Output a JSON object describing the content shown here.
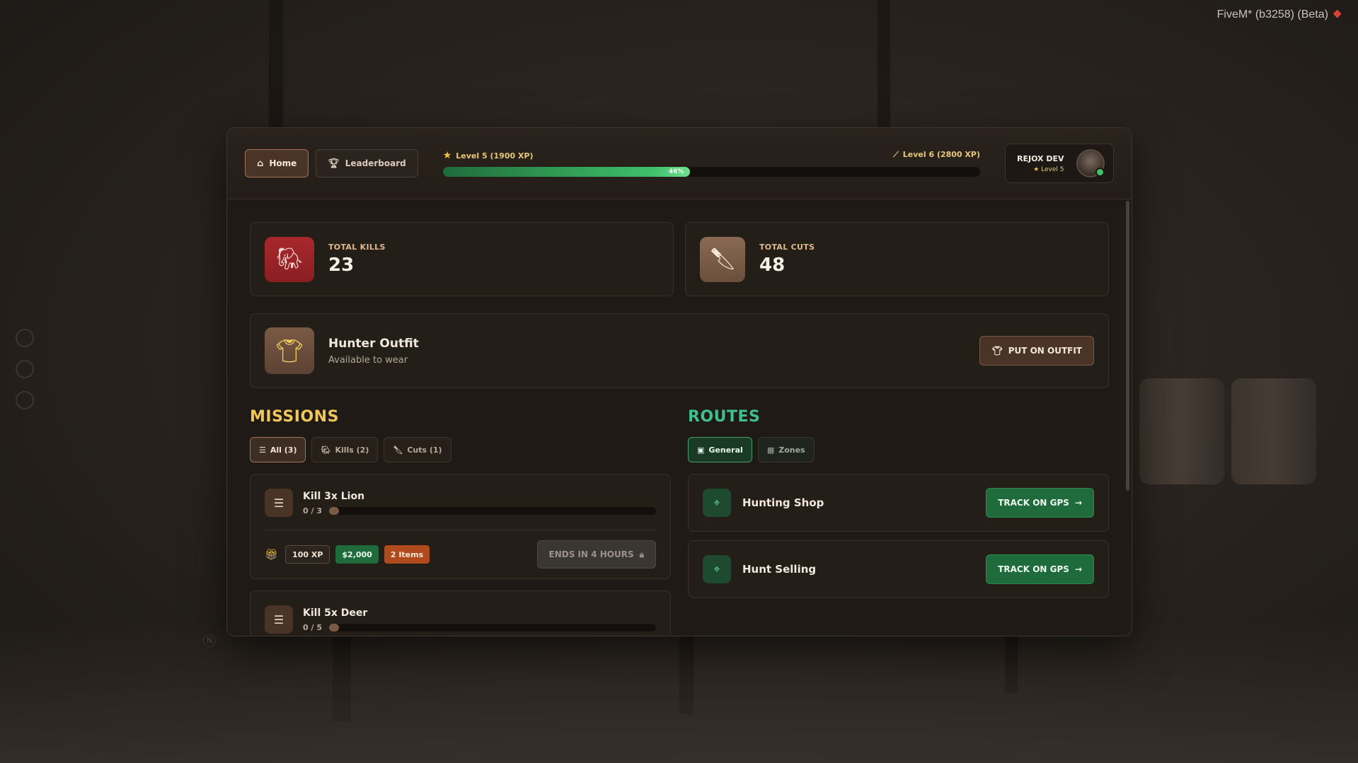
{
  "overlay": {
    "fivem_label": "FiveM* (b3258) (Beta)"
  },
  "nav": {
    "home_label": "Home",
    "leaderboard_label": "Leaderboard"
  },
  "xp": {
    "current_level": "Level 5 (1900 XP)",
    "next_level": "Level 6 (2800 XP)",
    "percent_label": "46%",
    "percent_value": 46
  },
  "profile": {
    "name": "REJOX DEV",
    "level": "Level 5"
  },
  "stats": {
    "kills_label": "TOTAL KILLS",
    "kills_value": "23",
    "cuts_label": "TOTAL CUTS",
    "cuts_value": "48"
  },
  "outfit": {
    "title": "Hunter Outfit",
    "subtitle": "Available to wear",
    "button_label": "PUT ON OUTFIT"
  },
  "missions": {
    "title": "MISSIONS",
    "filters": [
      "All (3)",
      "Kills (2)",
      "Cuts (1)"
    ],
    "items": [
      {
        "title": "Kill 3x Lion",
        "progress": "0 / 3",
        "rewards": [
          "100 XP",
          "$2,000",
          "2 Items"
        ],
        "ends": "ENDS IN 4 HOURS"
      },
      {
        "title": "Kill 5x Deer",
        "progress": "0 / 5"
      }
    ]
  },
  "routes": {
    "title": "ROUTES",
    "filters": [
      "General",
      "Zones"
    ],
    "items": [
      {
        "title": "Hunting Shop",
        "button_label": "TRACK ON GPS"
      },
      {
        "title": "Hunt Selling",
        "button_label": "TRACK ON GPS"
      }
    ]
  },
  "colors": {
    "accent_gold": "#f0c75a",
    "accent_green": "#3fc08a",
    "panel_bg": "#1f1a16"
  }
}
